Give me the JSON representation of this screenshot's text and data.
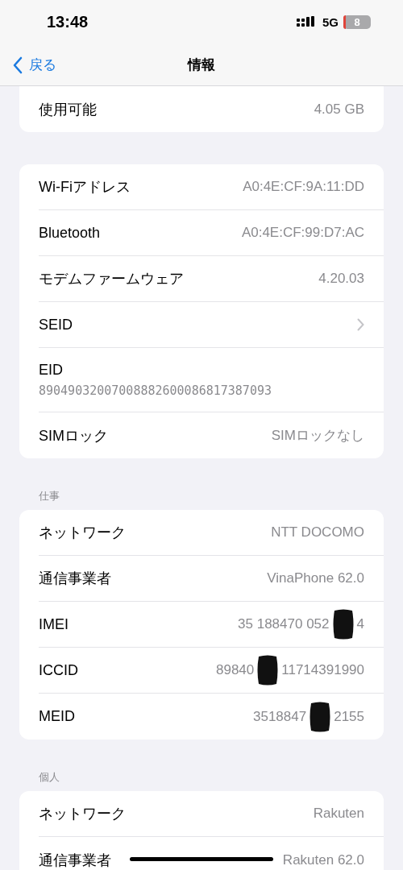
{
  "status_bar": {
    "time": "13:48",
    "network": "5G",
    "battery": "8"
  },
  "nav": {
    "back": "戻る",
    "title": "情報"
  },
  "sections": [
    {
      "rows": [
        {
          "kind": "value",
          "label": "使用可能",
          "value": "4.05 GB"
        }
      ]
    },
    {
      "rows": [
        {
          "kind": "value",
          "label": "Wi-Fiアドレス",
          "value": "A0:4E:CF:9A:11:DD"
        },
        {
          "kind": "value",
          "label": "Bluetooth",
          "value": "A0:4E:CF:99:D7:AC"
        },
        {
          "kind": "value",
          "label": "モデムファームウェア",
          "value": "4.20.03"
        },
        {
          "kind": "link",
          "label": "SEID"
        },
        {
          "kind": "stacked",
          "label": "EID",
          "value": "89049032007008882600086817387093"
        },
        {
          "kind": "value",
          "label": "SIMロック",
          "value": "SIMロックなし"
        }
      ]
    },
    {
      "header": "仕事",
      "rows": [
        {
          "kind": "value",
          "label": "ネットワーク",
          "value": "NTT DOCOMO"
        },
        {
          "kind": "value",
          "label": "通信事業者",
          "value": "VinaPhone 62.0"
        },
        {
          "kind": "redacted",
          "label": "IMEI",
          "value_parts": [
            "35 188470 052",
            "4"
          ]
        },
        {
          "kind": "redacted",
          "label": "ICCID",
          "value_parts": [
            "89840",
            "11714391990"
          ]
        },
        {
          "kind": "redacted",
          "label": "MEID",
          "value_parts": [
            "3518847",
            "2155"
          ]
        }
      ]
    },
    {
      "header": "個人",
      "rows": [
        {
          "kind": "value",
          "label": "ネットワーク",
          "value": "Rakuten"
        },
        {
          "kind": "value",
          "label": "通信事業者",
          "value": "Rakuten 62.0"
        }
      ]
    }
  ]
}
